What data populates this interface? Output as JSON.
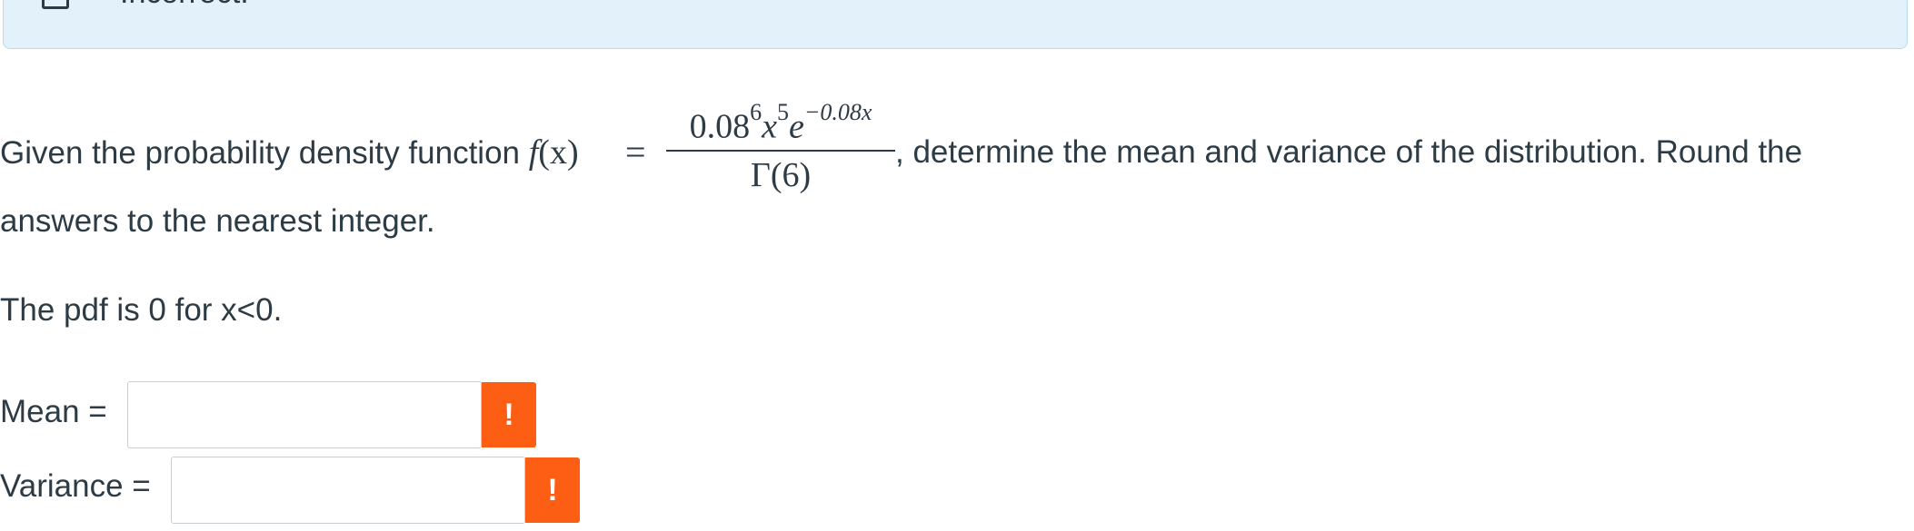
{
  "banner": {
    "status_text": "Incorrect.",
    "background": "#e3f1fa"
  },
  "question": {
    "intro": "Given the probability density function ",
    "function_name": "f",
    "function_arg": "(x)",
    "equals": "=",
    "numerator_base": "0.08",
    "numerator_base_exp": "6",
    "numerator_var": "x",
    "numerator_var_exp": "5",
    "numerator_exp_base": "e",
    "numerator_exp_power": "−0.08x",
    "denominator": "Γ(6)",
    "continuation_line1": ", determine the mean and variance of the distribution. Round the",
    "continuation_line2": "answers to the nearest integer.",
    "support_note": "The pdf is 0 for x<0."
  },
  "answers": {
    "mean_label": "Mean =",
    "mean_value": "",
    "variance_label": "Variance =",
    "variance_value": "",
    "warning_glyph": "!",
    "warning_color": "#fc5e13"
  }
}
